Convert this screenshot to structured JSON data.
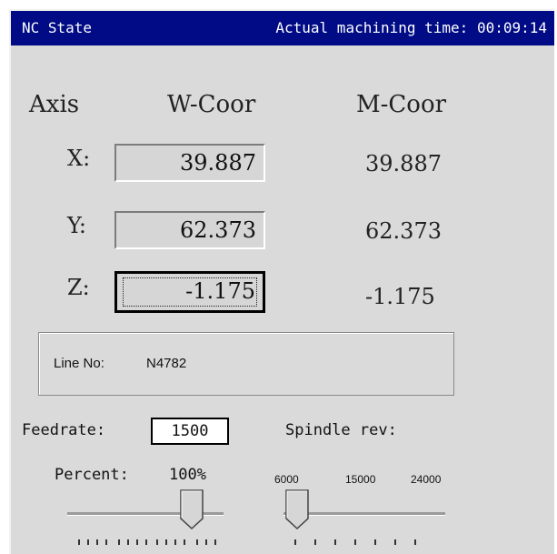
{
  "titlebar": {
    "title": "NC State",
    "time_label": "Actual machining time:",
    "time_value": "00:09:14"
  },
  "headers": {
    "axis": "Axis",
    "wcoor": "W-Coor",
    "mcoor": "M-Coor"
  },
  "axes": [
    {
      "label": "X:",
      "wcoor": "39.887",
      "mcoor": "39.887"
    },
    {
      "label": "Y:",
      "wcoor": "62.373",
      "mcoor": "62.373"
    },
    {
      "label": "Z:",
      "wcoor": "-1.175",
      "mcoor": "-1.175"
    }
  ],
  "line_no": {
    "label": "Line No:",
    "value": "N4782"
  },
  "feedrate": {
    "label": "Feedrate:",
    "value": "1500",
    "percent_label": "Percent:",
    "percent_value": "100%"
  },
  "spindle": {
    "label": "Spindle rev:",
    "scale_min": "6000",
    "scale_mid": "15000",
    "scale_max": "24000"
  }
}
